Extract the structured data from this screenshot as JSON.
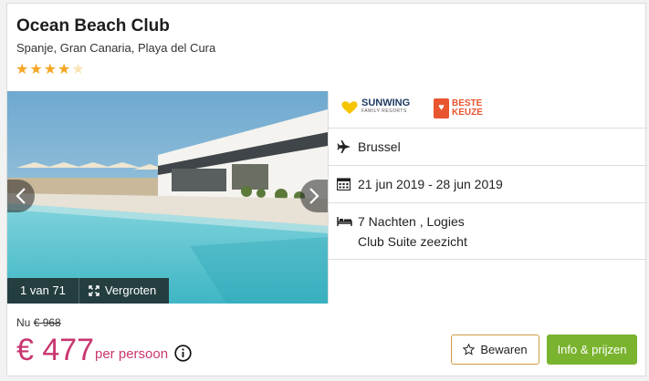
{
  "hotel": {
    "name": "Ocean Beach Club",
    "location": "Spanje, Gran Canaria, Playa del Cura",
    "rating": 4.5,
    "stars": [
      "★",
      "★",
      "★",
      "★",
      "★"
    ]
  },
  "gallery": {
    "counter": "1 van 71",
    "enlarge_label": "Vergroten"
  },
  "badges": {
    "tour_operator": "SUNWING",
    "tour_operator_sub": "FAMILY RESORTS",
    "best_choice_line1": "BESTE",
    "best_choice_line2": "KEUZE"
  },
  "details": {
    "departure": "Brussel",
    "dates": "21 jun 2019 - 28 jun 2019",
    "stay_line1": "7 Nachten , Logies",
    "stay_line2": "Club Suite zeezicht"
  },
  "pricing": {
    "prefix": "Nu",
    "old_price": "€ 968",
    "price": "€ 477",
    "per": "per persoon"
  },
  "actions": {
    "save_label": "Bewaren",
    "info_label": "Info & prijzen"
  },
  "colors": {
    "price": "#c8366f",
    "star": "#f5a623",
    "primary_button": "#7ab32e",
    "secondary_border": "#cf9b45"
  }
}
